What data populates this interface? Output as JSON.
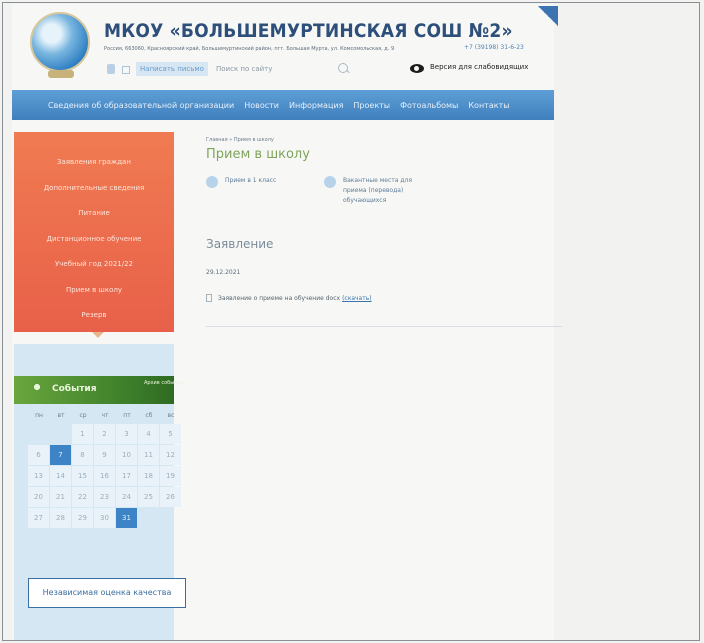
{
  "header": {
    "title": "МКОУ «БОЛЬШЕМУРТИНСКАЯ СОШ №2»",
    "address": "Россия, 663060, Красноярский край, Большемуртинский район, пгт. Большая Мурта, ул. Комсомольская, д. 9",
    "phone": "+7 (39198) 31-6-23",
    "ask_label": "Написать письмо",
    "search_placeholder": "Поиск по сайту",
    "low_vision_label": "Версия для слабовидящих"
  },
  "nav": {
    "items": [
      "Сведения об образовательной организации",
      "Новости",
      "Информация",
      "Проекты",
      "Фотоальбомы",
      "Контакты"
    ]
  },
  "sidebar": {
    "items": [
      "Заявления граждан",
      "Дополнительные сведения",
      "Питание",
      "Дистанционное обучение",
      "Учебный год 2021/22",
      "Прием в школу",
      "Резерв"
    ]
  },
  "events": {
    "title": "События",
    "archive": "Архив событий",
    "weekdays": [
      "пн",
      "вт",
      "ср",
      "чт",
      "пт",
      "сб",
      "вс"
    ],
    "weeks": [
      [
        "",
        "",
        "1",
        "2",
        "3",
        "4",
        "5"
      ],
      [
        "6",
        "7",
        "8",
        "9",
        "10",
        "11",
        "12"
      ],
      [
        "13",
        "14",
        "15",
        "16",
        "17",
        "18",
        "19"
      ],
      [
        "20",
        "21",
        "22",
        "23",
        "24",
        "25",
        "26"
      ],
      [
        "27",
        "28",
        "29",
        "30",
        "31",
        "",
        ""
      ]
    ],
    "today": "7",
    "highlight": "31"
  },
  "quality_label": "Независимая оценка качества",
  "main": {
    "breadcrumb": "Главная » Прием в школу",
    "title": "Прием в школу",
    "subpages": [
      "Прием в 1 класс",
      "Вакантные места для\nприема (перевода)\nобучающихся"
    ],
    "section_heading": "Заявление",
    "date": "29.12.2021",
    "document": {
      "text": "Заявление о приеме на обучение docx",
      "link": "(скачать)"
    }
  }
}
